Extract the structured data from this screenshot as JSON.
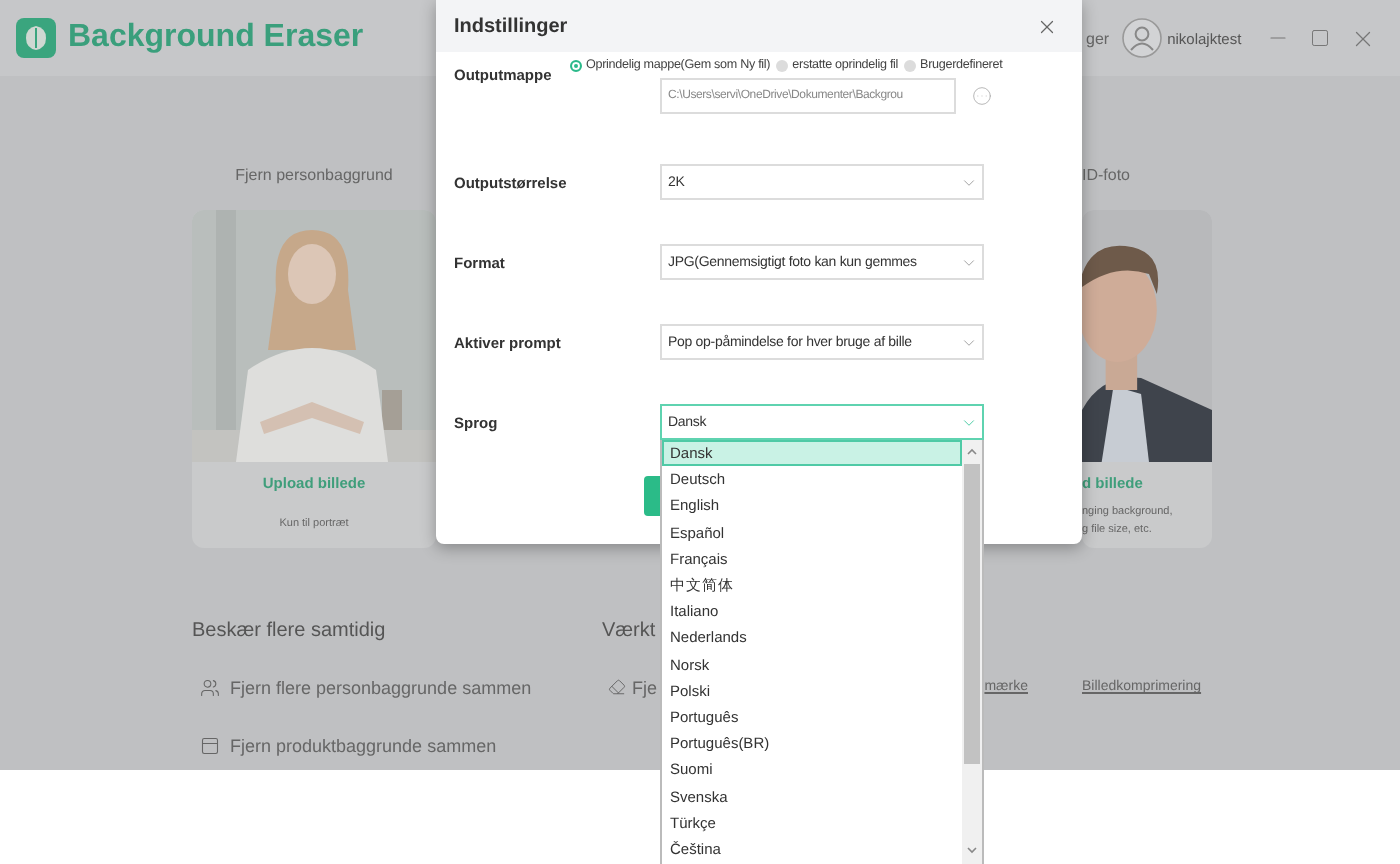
{
  "app": {
    "title": "Background Eraser",
    "header_link": "ger",
    "user": "nikolajktest"
  },
  "cards": [
    {
      "title": "Fjern personbaggrund",
      "upload": "Upload billede",
      "note": "Kun til portræt"
    },
    {
      "title": "ID-foto",
      "upload": "d billede",
      "note": "nging background,\ng file size, etc."
    }
  ],
  "batch": {
    "heading": "Beskær flere samtidig",
    "items": [
      {
        "label": "Fjern flere personbaggrunde sammen"
      },
      {
        "label": "Fjern produktbaggrunde sammen"
      }
    ]
  },
  "tools": {
    "heading": "Værkt",
    "items": [
      {
        "kind": "icon_text",
        "label": "Fje"
      },
      {
        "kind": "link",
        "label": "mærke"
      },
      {
        "kind": "link",
        "label": "Billedkomprimering"
      }
    ]
  },
  "dialog": {
    "title": "Indstillinger",
    "output_folder": {
      "label": "Outputmappe",
      "options": [
        {
          "label": "Oprindelig mappe(Gem som Ny fil)",
          "selected": true
        },
        {
          "label": "erstatte oprindelig fil",
          "selected": false
        },
        {
          "label": "Brugerdefineret",
          "selected": false
        }
      ],
      "path": "C:\\Users\\servi\\OneDrive\\Dokumenter\\Backgrou"
    },
    "selects": [
      {
        "label": "Outputstørrelse",
        "value": "2K",
        "focused": false
      },
      {
        "label": "Format",
        "value": "JPG(Gennemsigtigt foto kan kun gemmes",
        "focused": false
      },
      {
        "label": "Aktiver prompt",
        "value": "Pop op-påmindelse for hver bruge af bille",
        "focused": false
      },
      {
        "label": "Sprog",
        "value": "Dansk",
        "focused": true
      }
    ]
  },
  "language_list": [
    {
      "label": "Dansk",
      "selected": true
    },
    {
      "label": "Deutsch",
      "selected": false
    },
    {
      "label": "English",
      "selected": false
    },
    {
      "label": "Español",
      "selected": false
    },
    {
      "label": "Français",
      "selected": false
    },
    {
      "label": "中文简体",
      "selected": false
    },
    {
      "label": "Italiano",
      "selected": false
    },
    {
      "label": "Nederlands",
      "selected": false
    },
    {
      "label": "Norsk",
      "selected": false
    },
    {
      "label": "Polski",
      "selected": false
    },
    {
      "label": "Português",
      "selected": false
    },
    {
      "label": "Português(BR)",
      "selected": false
    },
    {
      "label": "Suomi",
      "selected": false
    },
    {
      "label": "Svenska",
      "selected": false
    },
    {
      "label": "Türkçe",
      "selected": false
    },
    {
      "label": "Čeština",
      "selected": false
    }
  ]
}
